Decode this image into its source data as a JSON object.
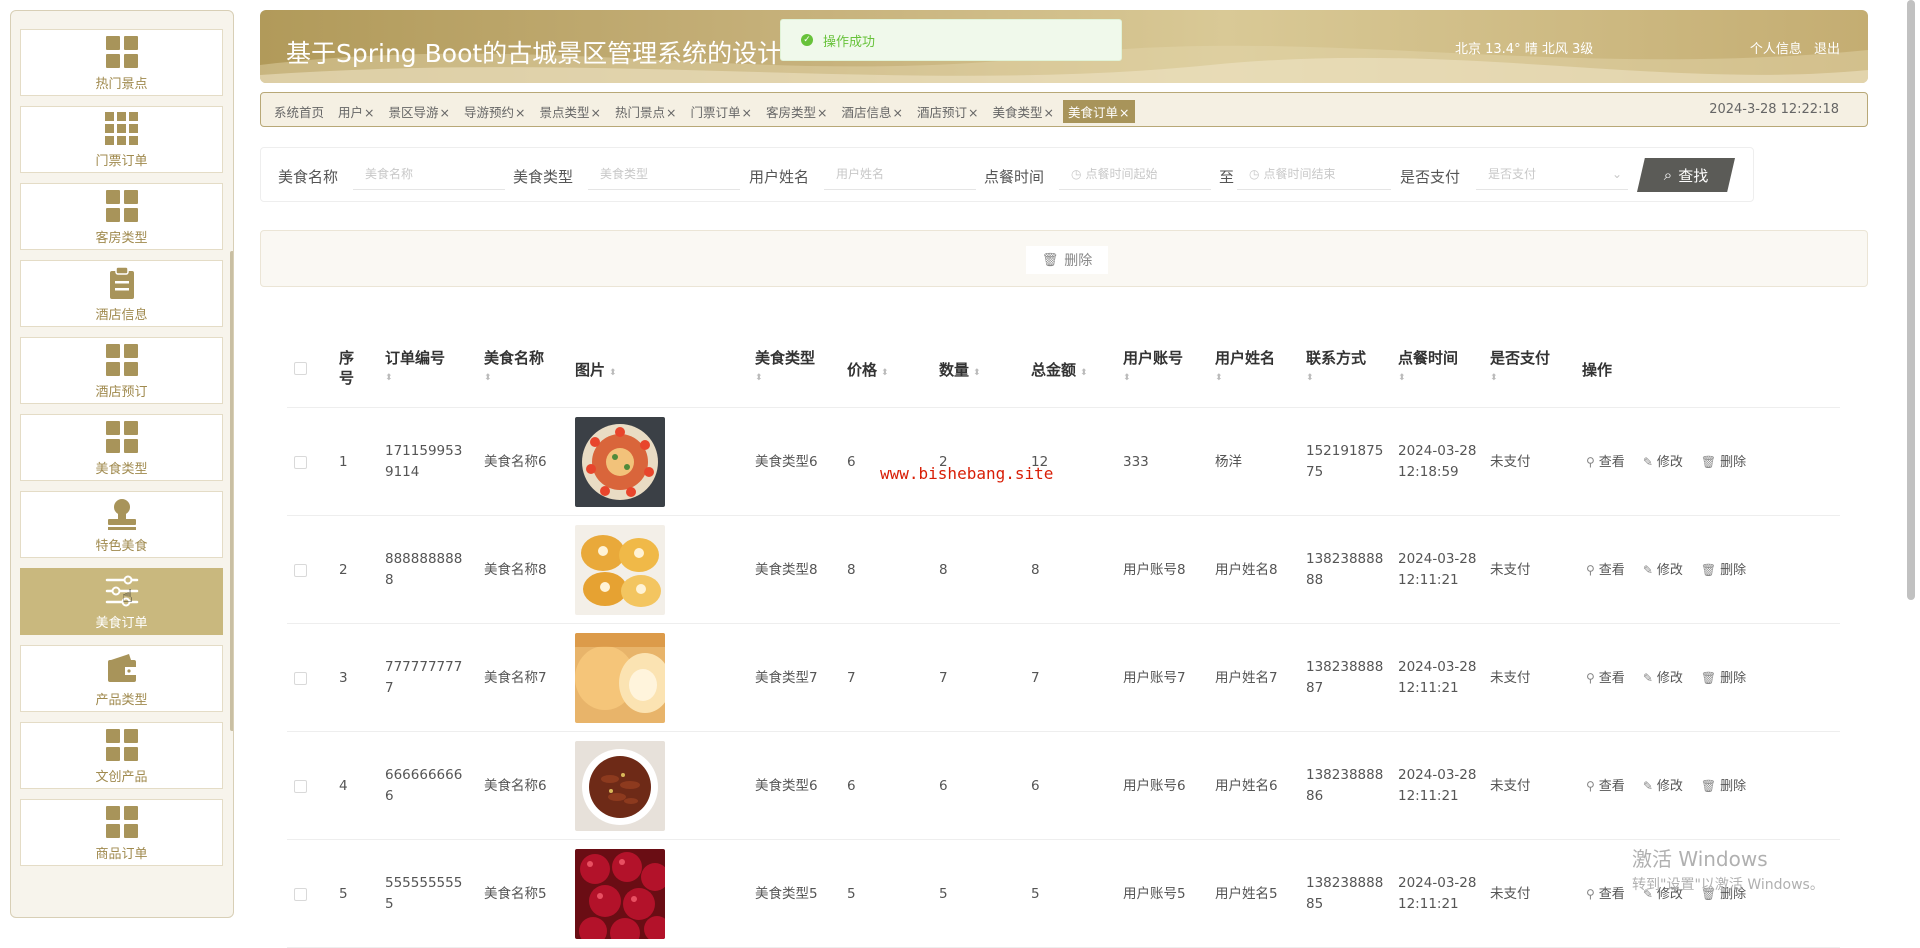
{
  "sidebar": {
    "items": [
      {
        "label": "热门景点",
        "icon": "grid-icon"
      },
      {
        "label": "门票订单",
        "icon": "grid9-icon"
      },
      {
        "label": "客房类型",
        "icon": "grid-icon"
      },
      {
        "label": "酒店信息",
        "icon": "clipboard-icon"
      },
      {
        "label": "酒店预订",
        "icon": "grid-icon"
      },
      {
        "label": "美食类型",
        "icon": "grid-icon"
      },
      {
        "label": "特色美食",
        "icon": "stamp-icon"
      },
      {
        "label": "美食订单",
        "icon": "sliders-icon",
        "active": true
      },
      {
        "label": "产品类型",
        "icon": "wallet-icon"
      },
      {
        "label": "文创产品",
        "icon": "grid-icon"
      },
      {
        "label": "商品订单",
        "icon": "grid-icon"
      }
    ]
  },
  "header": {
    "title": "基于Spring Boot的古城景区管理系统的设计",
    "weather": "北京  13.4°  晴  北风  3级",
    "links": [
      "个人信息",
      "退出"
    ],
    "colors": {
      "accent": "#b19a5a",
      "active_tab": "#a8945a"
    }
  },
  "toast": {
    "message": "操作成功",
    "icon": "check-circle-icon"
  },
  "tags": {
    "items": [
      {
        "label": "系统首页",
        "closable": false
      },
      {
        "label": "用户",
        "closable": true
      },
      {
        "label": "景区导游",
        "closable": true
      },
      {
        "label": "导游预约",
        "closable": true
      },
      {
        "label": "景点类型",
        "closable": true
      },
      {
        "label": "热门景点",
        "closable": true
      },
      {
        "label": "门票订单",
        "closable": true
      },
      {
        "label": "客房类型",
        "closable": true
      },
      {
        "label": "酒店信息",
        "closable": true
      },
      {
        "label": "酒店预订",
        "closable": true
      },
      {
        "label": "美食类型",
        "closable": true
      },
      {
        "label": "美食订单",
        "closable": true,
        "active": true
      }
    ],
    "close_glyph": "×",
    "datetime": "2024-3-28 12:22:18"
  },
  "search": {
    "food_name_label": "美食名称",
    "food_name_placeholder": "美食名称",
    "food_type_label": "美食类型",
    "food_type_placeholder": "美食类型",
    "user_name_label": "用户姓名",
    "user_name_placeholder": "用户姓名",
    "time_label": "点餐时间",
    "time_start_placeholder": "点餐时间起始",
    "time_sep": "至",
    "time_end_placeholder": "点餐时间结束",
    "paid_label": "是否支付",
    "paid_placeholder": "是否支付",
    "button": "查找"
  },
  "actions": {
    "delete": "删除"
  },
  "table": {
    "headers": {
      "index": "序号",
      "order_no": "订单编号",
      "food_name": "美食名称",
      "image": "图片",
      "food_type": "美食类型",
      "price": "价格",
      "quantity": "数量",
      "total": "总金额",
      "account": "用户账号",
      "user_name": "用户姓名",
      "contact": "联系方式",
      "time": "点餐时间",
      "paid": "是否支付",
      "ops": "操作"
    },
    "ops": {
      "view": "查看",
      "edit": "修改",
      "delete": "删除"
    },
    "rows": [
      {
        "index": "1",
        "order_no": "1711599539114",
        "food_name": "美食名称6",
        "food_type": "美食类型6",
        "price": "6",
        "quantity": "2",
        "total": "12",
        "account": "333",
        "user_name": "杨洋",
        "contact": "15219187575",
        "time": "2024-03-28 12:18:59",
        "paid": "未支付",
        "image": "shrimp-dish"
      },
      {
        "index": "2",
        "order_no": "8888888888",
        "food_name": "美食名称8",
        "food_type": "美食类型8",
        "price": "8",
        "quantity": "8",
        "total": "8",
        "account": "用户账号8",
        "user_name": "用户姓名8",
        "contact": "13823888888",
        "time": "2024-03-28 12:11:21",
        "paid": "未支付",
        "image": "dumpling-dish"
      },
      {
        "index": "3",
        "order_no": "7777777777",
        "food_name": "美食名称7",
        "food_type": "美食类型7",
        "price": "7",
        "quantity": "7",
        "total": "7",
        "account": "用户账号7",
        "user_name": "用户姓名7",
        "contact": "13823888887",
        "time": "2024-03-28 12:11:21",
        "paid": "未支付",
        "image": "bun-dish"
      },
      {
        "index": "4",
        "order_no": "6666666666",
        "food_name": "美食名称6",
        "food_type": "美食类型6",
        "price": "6",
        "quantity": "6",
        "total": "6",
        "account": "用户账号6",
        "user_name": "用户姓名6",
        "contact": "13823888886",
        "time": "2024-03-28 12:11:21",
        "paid": "未支付",
        "image": "braised-dish"
      },
      {
        "index": "5",
        "order_no": "5555555555",
        "food_name": "美食名称5",
        "food_type": "美食类型5",
        "price": "5",
        "quantity": "5",
        "total": "5",
        "account": "用户账号5",
        "user_name": "用户姓名5",
        "contact": "13823888885",
        "time": "2024-03-28 12:11:21",
        "paid": "未支付",
        "image": "cherry-dish"
      }
    ]
  },
  "overlay": {
    "watermark": "www.bishebang.site",
    "windows_line1": "激活 Windows",
    "windows_line2": "转到\"设置\"以激活 Windows。"
  }
}
